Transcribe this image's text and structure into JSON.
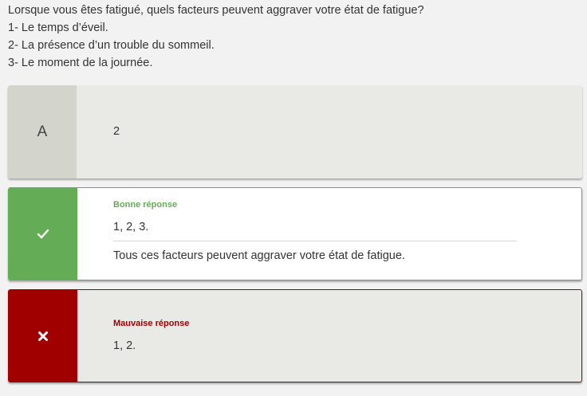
{
  "question": {
    "text": "Lorsque vous êtes fatigué, quels facteurs peuvent aggraver votre état de fatigue?",
    "items": [
      "1- Le temps d’éveil.",
      "2- La présence d’un trouble du sommeil.",
      "3- Le moment de la journée."
    ]
  },
  "option_a": {
    "letter": "A",
    "value": "2"
  },
  "correct": {
    "label": "Bonne réponse",
    "answer": "1, 2, 3.",
    "explanation": "Tous ces facteurs peuvent aggraver votre état de fatigue.",
    "icon": "checkmark-icon",
    "color": "#64ad56"
  },
  "wrong": {
    "label": "Mauvaise réponse",
    "answer": "1, 2.",
    "icon": "cross-icon",
    "color": "#a00000"
  }
}
